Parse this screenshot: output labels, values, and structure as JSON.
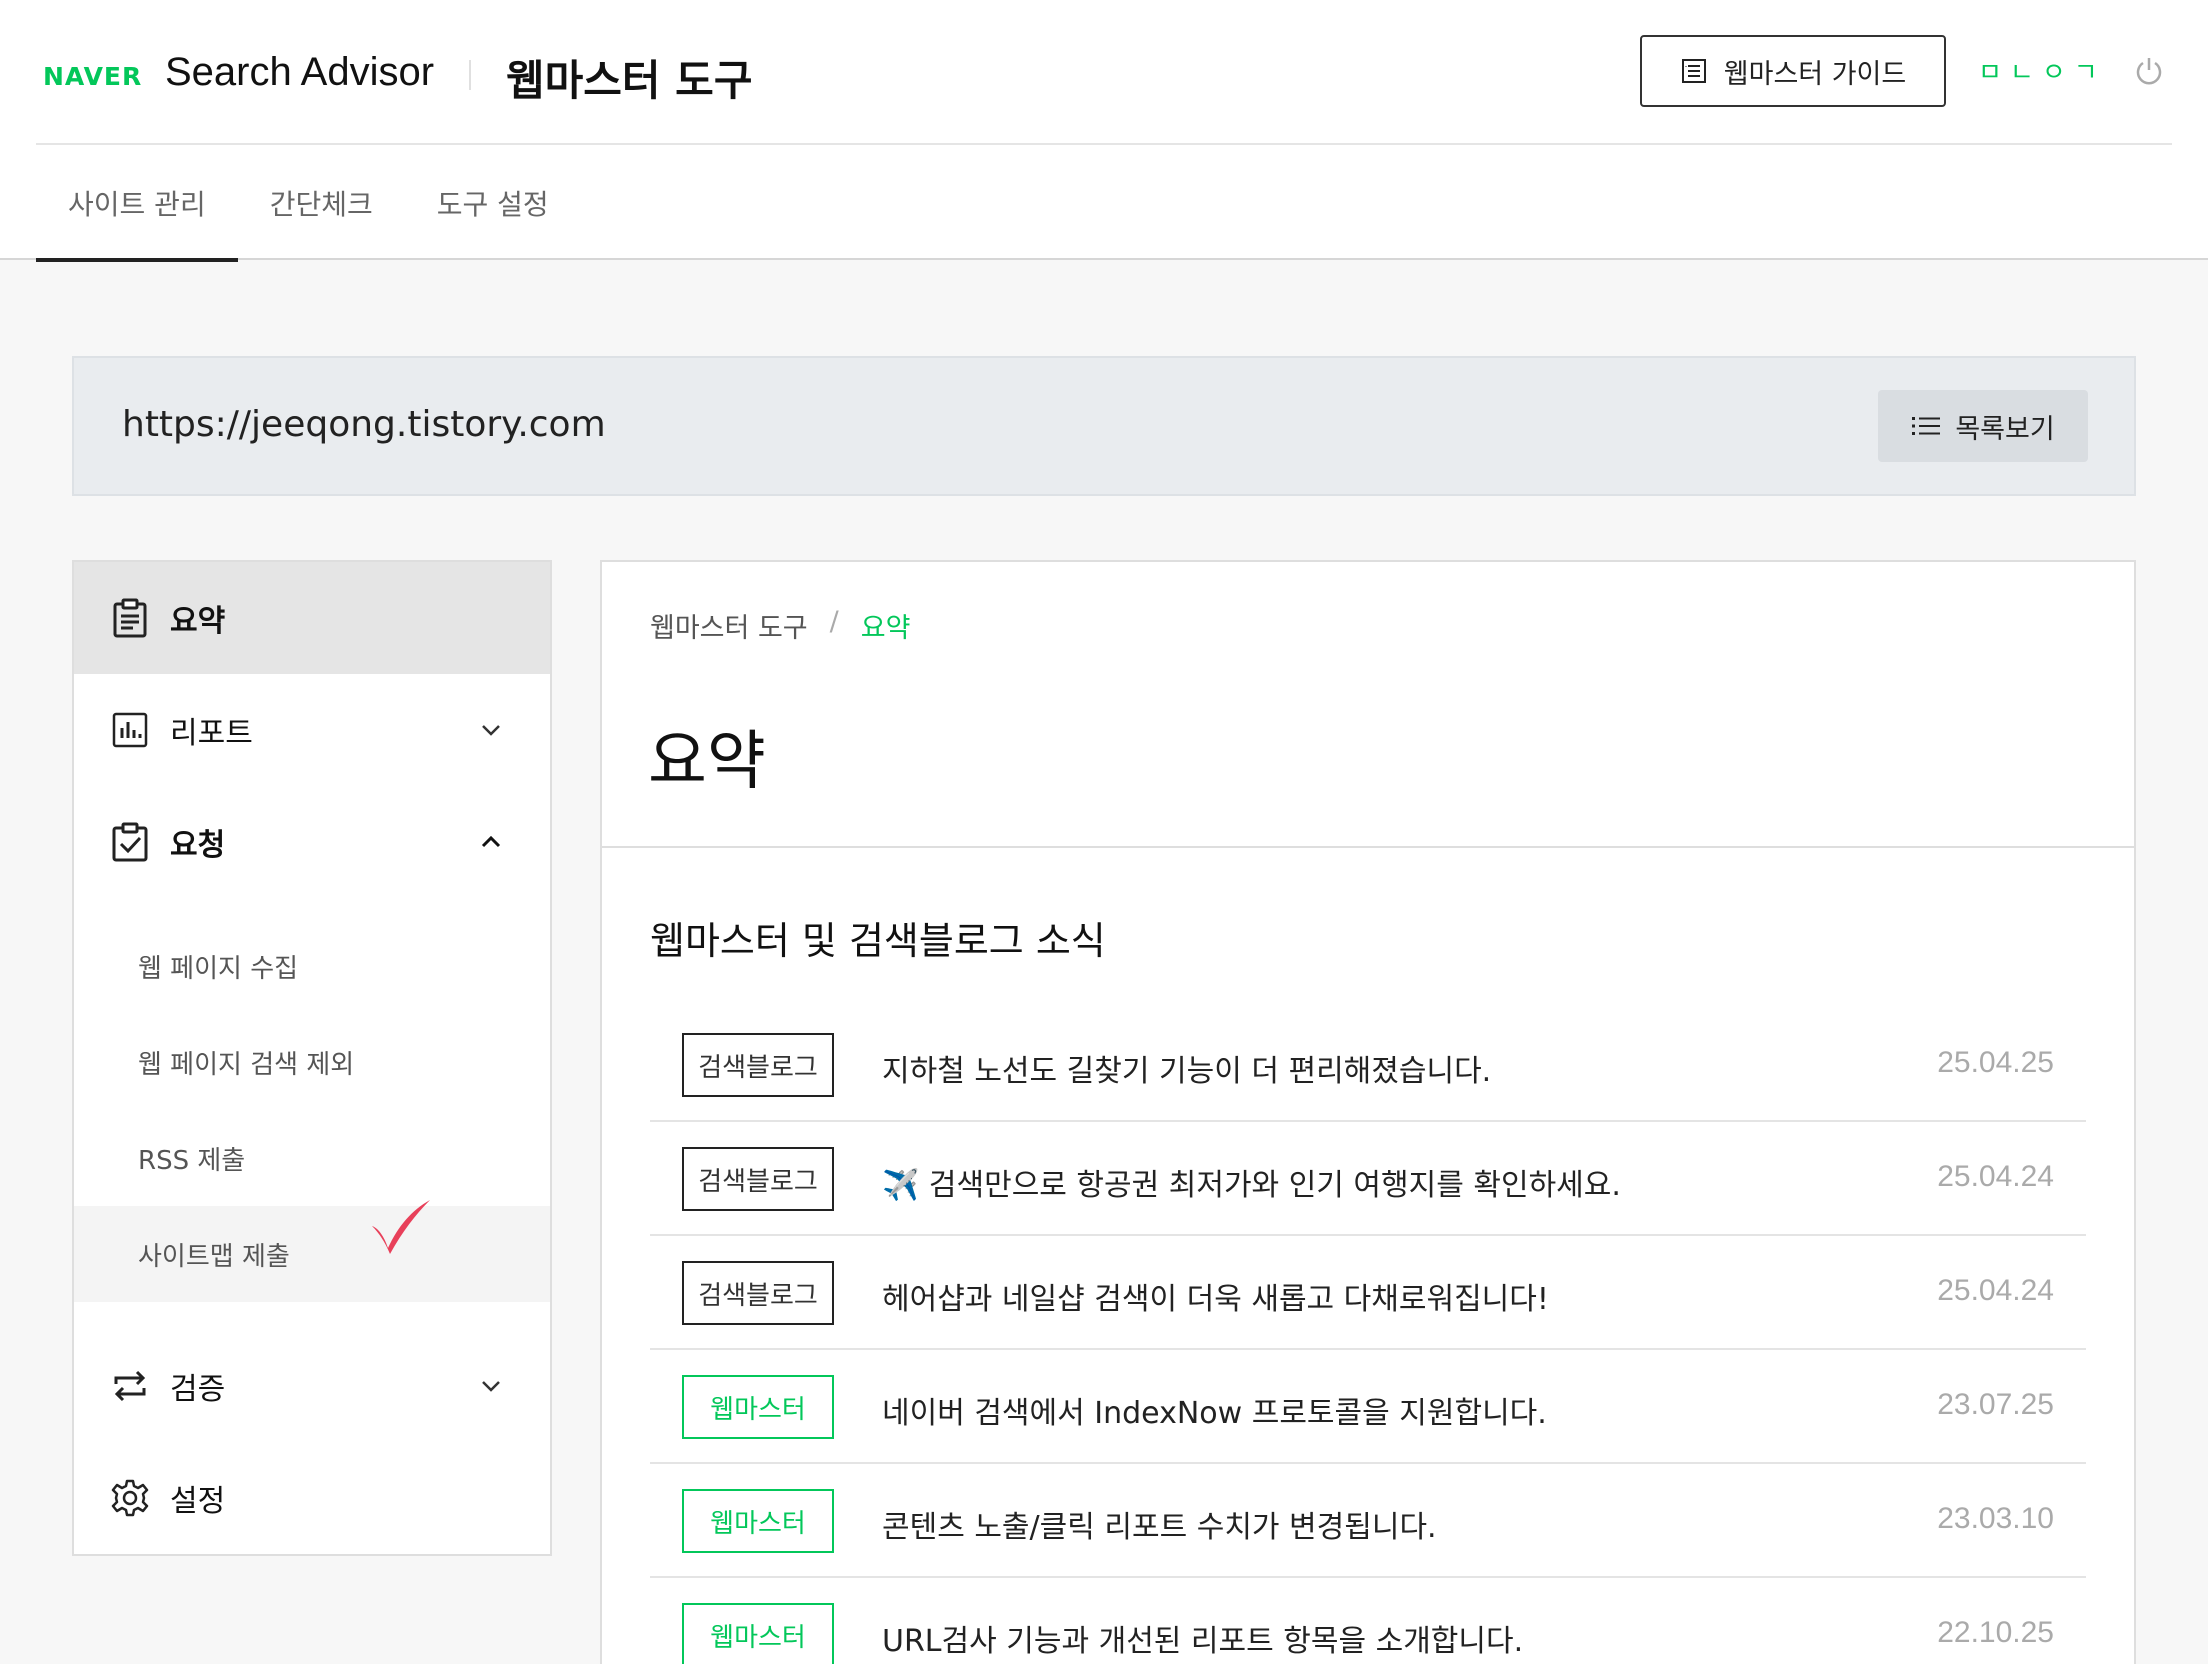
{
  "header": {
    "naver_logo": "NAVER",
    "app_title": "Search Advisor",
    "tool_title": "웹마스터 도구",
    "guide_button": "웹마스터 가이드",
    "login": "ㅁㄴㅇㄱ"
  },
  "tabs": [
    {
      "label": "사이트 관리",
      "active": true
    },
    {
      "label": "간단체크",
      "active": false
    },
    {
      "label": "도구 설정",
      "active": false
    }
  ],
  "site": {
    "url": "https://jeeqong.tistory.com",
    "list_button": "목록보기"
  },
  "sidebar": {
    "summary": "요약",
    "report": "리포트",
    "request": "요청",
    "request_items": [
      "웹 페이지 수집",
      "웹 페이지 검색 제외",
      "RSS 제출",
      "사이트맵 제출"
    ],
    "verify": "검증",
    "settings": "설정"
  },
  "content": {
    "breadcrumb": [
      "웹마스터 도구",
      "/",
      "요약"
    ],
    "page_title": "요약",
    "section_title": "웹마스터 및 검색블로그 소식",
    "news": [
      {
        "tag": "검색블로그",
        "title": "지하철 노선도 길찾기 기능이 더 편리해졌습니다.",
        "date": "25.04.25"
      },
      {
        "tag": "검색블로그",
        "title": "✈️ 검색만으로 항공권 최저가와 인기 여행지를 확인하세요.",
        "date": "25.04.24"
      },
      {
        "tag": "검색블로그",
        "title": "헤어샵과 네일샵 검색이 더욱 새롭고 다채로워집니다!",
        "date": "25.04.24"
      },
      {
        "tag": "웹마스터",
        "title": "네이버 검색에서 IndexNow 프로토콜을 지원합니다.",
        "date": "23.07.25"
      },
      {
        "tag": "웹마스터",
        "title": "콘텐츠 노출/클릭 리포트 수치가 변경됩니다.",
        "date": "23.03.10"
      },
      {
        "tag": "웹마스터",
        "title": "URL검사 기능과 개선된 리포트 항목을 소개합니다.",
        "date": "22.10.25"
      }
    ]
  },
  "colors": {
    "brand_green": "#03c75a",
    "annotation_check": "#e8405a"
  }
}
